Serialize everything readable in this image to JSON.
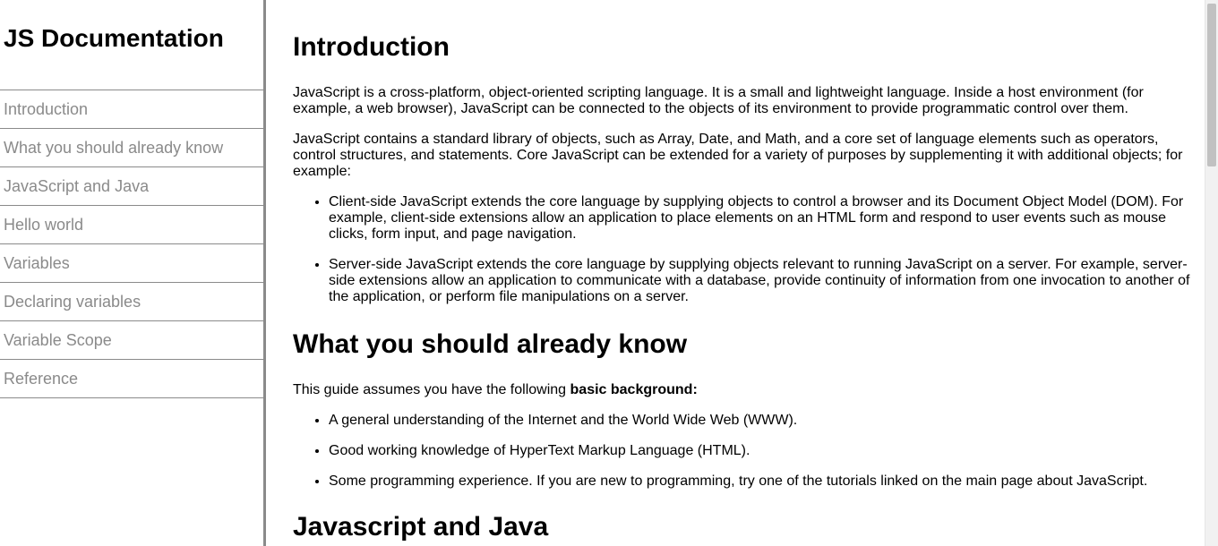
{
  "navbar": {
    "title": "JS Documentation",
    "items": [
      {
        "label": "Introduction"
      },
      {
        "label": "What you should already know"
      },
      {
        "label": "JavaScript and Java"
      },
      {
        "label": "Hello world"
      },
      {
        "label": "Variables"
      },
      {
        "label": "Declaring variables"
      },
      {
        "label": "Variable Scope"
      },
      {
        "label": "Reference"
      }
    ]
  },
  "main": {
    "introduction": {
      "header": "Introduction",
      "p1": "JavaScript is a cross-platform, object-oriented scripting language. It is a small and lightweight language. Inside a host environment (for example, a web browser), JavaScript can be connected to the objects of its environment to provide programmatic control over them.",
      "p2": "JavaScript contains a standard library of objects, such as Array, Date, and Math, and a core set of language elements such as operators, control structures, and statements. Core JavaScript can be extended for a variety of purposes by supplementing it with additional objects; for example:",
      "bullets": [
        "Client-side JavaScript extends the core language by supplying objects to control a browser and its Document Object Model (DOM). For example, client-side extensions allow an application to place elements on an HTML form and respond to user events such as mouse clicks, form input, and page navigation.",
        "Server-side JavaScript extends the core language by supplying objects relevant to running JavaScript on a server. For example, server-side extensions allow an application to communicate with a database, provide continuity of information from one invocation to another of the application, or perform file manipulations on a server."
      ]
    },
    "already_know": {
      "header": "What you should already know",
      "intro_prefix": "This guide assumes you have the following ",
      "intro_bold": "basic background:",
      "bullets": [
        "A general understanding of the Internet and the World Wide Web (WWW).",
        "Good working knowledge of HyperText Markup Language (HTML).",
        "Some programming experience. If you are new to programming, try one of the tutorials linked on the main page about JavaScript."
      ]
    },
    "js_and_java": {
      "header": "Javascript and Java"
    }
  }
}
